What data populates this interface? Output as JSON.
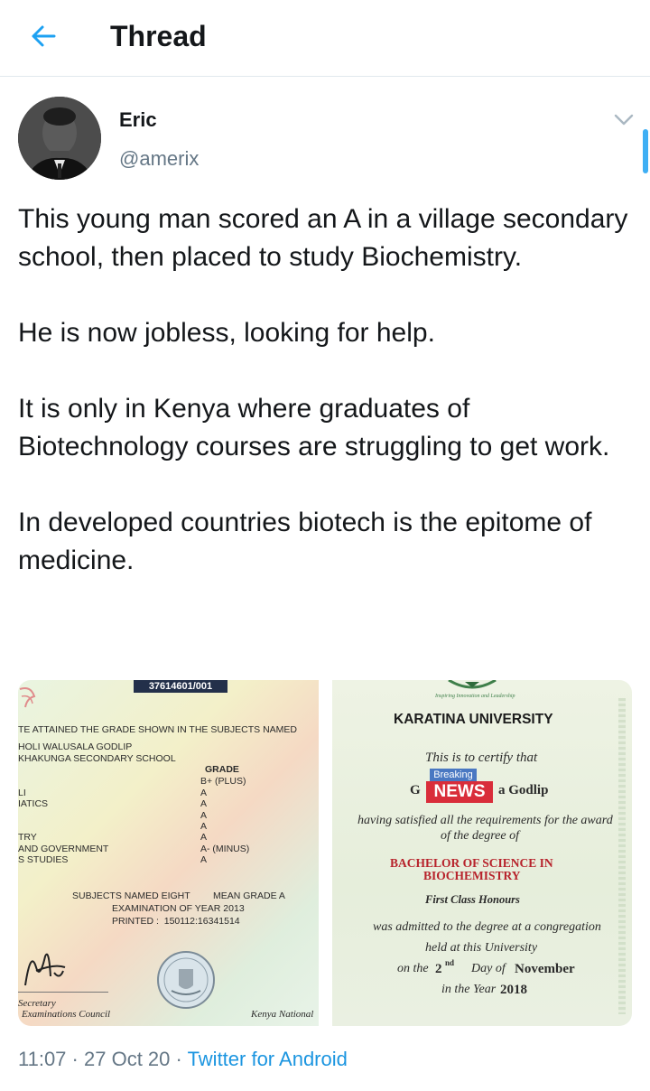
{
  "header": {
    "title": "Thread"
  },
  "tweet": {
    "author_name": "Eric",
    "author_handle": "@amerix",
    "paragraphs": [
      "This young man scored an A in a village secondary school, then placed to study Biochemistry.",
      "He is now jobless, looking for help.",
      "It is only in Kenya where graduates of Biotechnology courses are struggling to get work.",
      "In developed countries biotech is the epitome of medicine."
    ],
    "time": "11:07",
    "date": "27 Oct 20",
    "source": "Twitter for Android"
  },
  "left_certificate": {
    "serial": "37614601/001",
    "heading": "TE ATTAINED THE GRADE SHOWN IN THE SUBJECTS NAMED",
    "name": "HOLI WALUSALA GODLIP",
    "school": "KHAKUNGA SECONDARY SCHOOL",
    "grade_header": "GRADE",
    "subjects": [
      "",
      "LI",
      "IATICS",
      "",
      "",
      "TRY",
      "AND GOVERNMENT",
      "S STUDIES"
    ],
    "grades": [
      "B+ (PLUS)",
      "A",
      "A",
      "A",
      "A",
      "A",
      "A- (MINUS)",
      "A"
    ],
    "summary_left": "SUBJECTS NAMED EIGHT",
    "summary_right": "MEAN GRADE A",
    "exam_year": "EXAMINATION OF YEAR 2013",
    "printed": "PRINTED :  150112:16341514",
    "secretary": "Secretary",
    "council": "Examinations Council",
    "kenya_national": "Kenya National"
  },
  "right_certificate": {
    "motto": "Inspiring Innovation and Leadership",
    "university": "KARATINA UNIVERSITY",
    "certify": "This is to certify that",
    "name_prefix": "G",
    "name_suffix": "a Godlip",
    "breaking": "Breaking",
    "news": "NEWS",
    "satisfied": "having satisfied all the requirements for the award",
    "degree_of": "of the degree of",
    "degree_line1": "BACHELOR OF SCIENCE IN",
    "degree_line2": "BIOCHEMISTRY",
    "honours": "First Class Honours",
    "admitted": "was admitted to the degree at a congregation",
    "held": "held at this University",
    "on_the": "on the",
    "day_num": "2",
    "day_sup": "nd",
    "day_of": "Day of",
    "month": "November",
    "in_year": "in the Year",
    "year": "2018"
  },
  "colors": {
    "accent": "#1da1f2",
    "link": "#1b95e0",
    "muted": "#657786"
  }
}
